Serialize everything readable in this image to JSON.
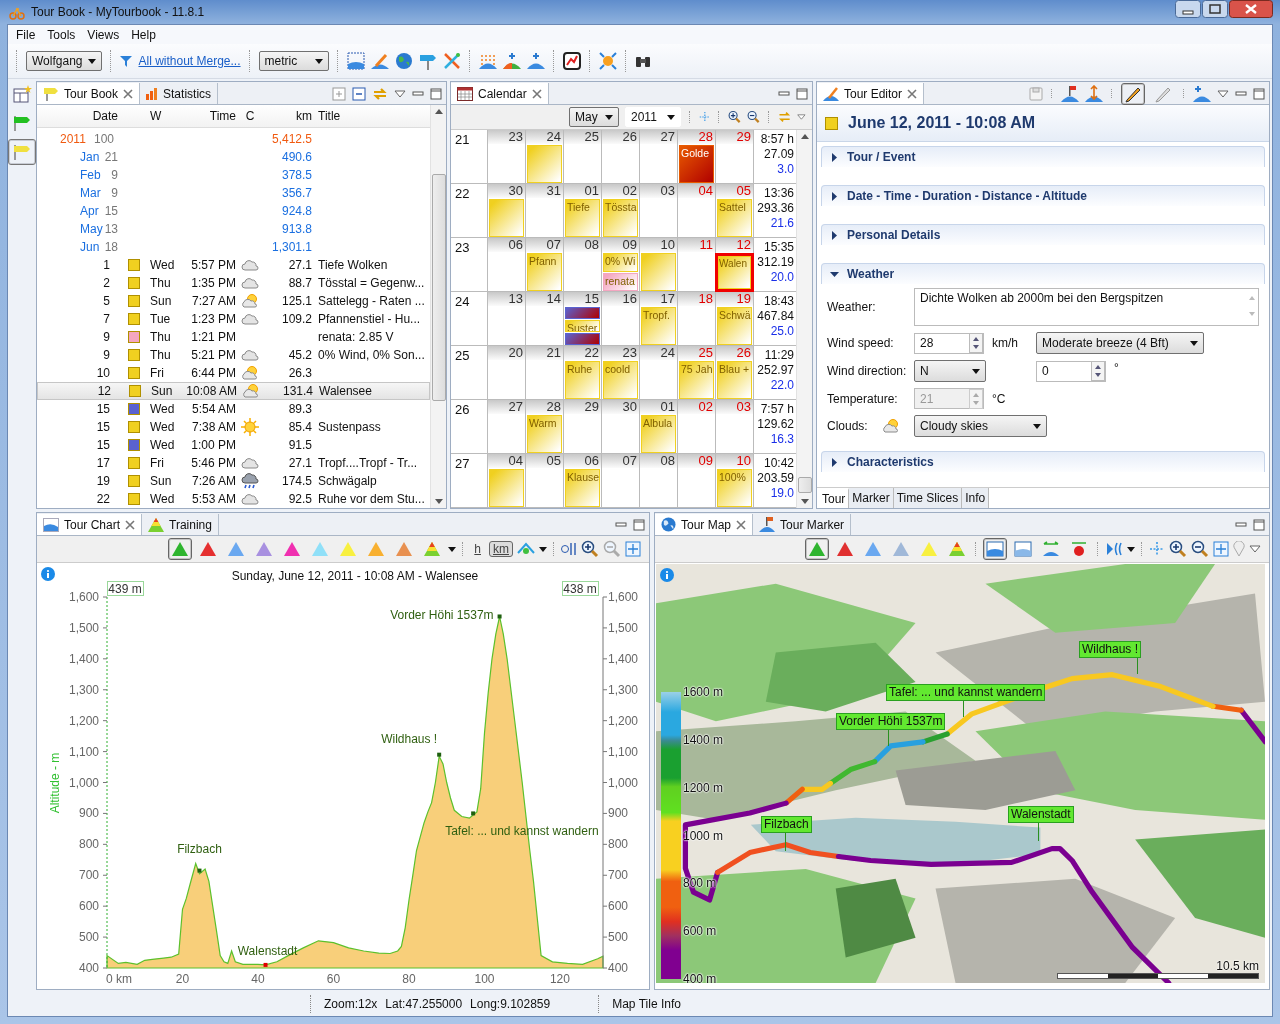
{
  "window": {
    "title": "Tour Book - MyTourbook - 11.8.1"
  },
  "menu": [
    "File",
    "Tools",
    "Views",
    "Help"
  ],
  "toolbar": {
    "person": "Wolfgang",
    "filter_link": "All without Merge...",
    "measurement": "metric"
  },
  "perspective_buttons": [
    {
      "kind": "layout",
      "selected": false
    },
    {
      "kind": "flag",
      "color": "#22c022",
      "selected": false
    },
    {
      "kind": "flag",
      "color": "#f0e040",
      "selected": true
    }
  ],
  "tour_book": {
    "tabs": [
      {
        "label": "Tour Book",
        "selected": true
      },
      {
        "label": "Statistics",
        "selected": false
      }
    ],
    "columns": [
      "Date",
      "W",
      "Time",
      "C",
      "km",
      "Title"
    ],
    "years": [
      {
        "year": "2011",
        "count": "100",
        "km": "5,412.5",
        "children": [
          {
            "month": "Jan",
            "count": "21",
            "km": "490.6"
          },
          {
            "month": "Feb",
            "count": "9",
            "km": "378.5"
          },
          {
            "month": "Mar",
            "count": "9",
            "km": "356.7"
          },
          {
            "month": "Apr",
            "count": "15",
            "km": "924.8"
          },
          {
            "month": "May",
            "count": "13",
            "km": "913.8"
          },
          {
            "month": "Jun",
            "count": "18",
            "km": "1,301.1",
            "children": [
              {
                "day": "1",
                "color": "#f0d020",
                "weekday": "Wed",
                "time": "5:57 PM",
                "kind": "cloudy",
                "km": "27.1",
                "title": "Tiefe Wolken",
                "selected": false
              },
              {
                "day": "2",
                "color": "#f0d020",
                "weekday": "Thu",
                "time": "1:35 PM",
                "kind": "cloudy",
                "km": "88.7",
                "title": "Tösstal = Gegenw...",
                "selected": false
              },
              {
                "day": "5",
                "color": "#f0d020",
                "weekday": "Sun",
                "time": "7:27 AM",
                "kind": "partly_sunny",
                "km": "125.1",
                "title": "Sattelegg - Raten ...",
                "selected": false
              },
              {
                "day": "7",
                "color": "#f0d020",
                "weekday": "Tue",
                "time": "1:23 PM",
                "kind": "cloudy",
                "km": "109.2",
                "title": "Pfannenstiel - Hu...",
                "selected": false
              },
              {
                "day": "9",
                "color": "#f4a6c0",
                "weekday": "Thu",
                "time": "1:21 PM",
                "title": "renata: 2.85 V",
                "selected": false
              },
              {
                "day": "9",
                "color": "#f0d020",
                "weekday": "Thu",
                "time": "5:21 PM",
                "kind": "cloudy",
                "km": "45.2",
                "title": "0% Wind, 0% Son...",
                "selected": false
              },
              {
                "day": "10",
                "color": "#f0d020",
                "weekday": "Fri",
                "time": "6:44 PM",
                "kind": "partly_sunny",
                "km": "26.3",
                "selected": false
              },
              {
                "day": "12",
                "color": "#f0d020",
                "weekday": "Sun",
                "time": "10:08 AM",
                "kind": "partly_sunny",
                "km": "131.4",
                "title": "Walensee",
                "selected": true
              },
              {
                "day": "15",
                "color": "#5a62d0",
                "weekday": "Wed",
                "time": "5:54 AM",
                "km": "89.3",
                "selected": false
              },
              {
                "day": "15",
                "color": "#f0d020",
                "weekday": "Wed",
                "time": "7:38 AM",
                "kind": "sunny",
                "km": "85.4",
                "title": "Sustenpass",
                "selected": false
              },
              {
                "day": "15",
                "color": "#5a62d0",
                "weekday": "Wed",
                "time": "1:00 PM",
                "km": "91.5",
                "selected": false
              },
              {
                "day": "17",
                "color": "#f0d020",
                "weekday": "Fri",
                "time": "5:46 PM",
                "kind": "cloudy",
                "km": "27.1",
                "title": "Tropf....Tropf - Tr...",
                "selected": false
              },
              {
                "day": "19",
                "color": "#f0d020",
                "weekday": "Sun",
                "time": "7:26 AM",
                "kind": "rain",
                "km": "174.5",
                "title": "Schwägalp",
                "selected": false
              },
              {
                "day": "22",
                "color": "#f0d020",
                "weekday": "Wed",
                "time": "5:53 AM",
                "kind": "cloudy",
                "km": "92.5",
                "title": "Ruhe vor dem Stu...",
                "selected": false
              }
            ]
          }
        ]
      }
    ]
  },
  "calendar": {
    "tab": "Calendar",
    "month": "May",
    "year": "2011",
    "weeks": [
      {
        "week": "21",
        "days": [
          {
            "day": "23"
          },
          {
            "day": "24",
            "tours": [
              {
                "color": "#f0d020",
                "selected": false
              }
            ]
          },
          {
            "day": "25"
          },
          {
            "day": "26"
          },
          {
            "day": "27"
          },
          {
            "day": "28",
            "tours": [
              {
                "color": "#e85a00",
                "title": "Golde",
                "selected": false
              }
            ]
          },
          {
            "day": "29"
          }
        ],
        "summary": [
          "8:57 h",
          "27.09",
          "3.0"
        ]
      },
      {
        "week": "22",
        "days": [
          {
            "day": "30",
            "tours": [
              {
                "color": "#f0d020",
                "selected": false
              }
            ]
          },
          {
            "day": "31"
          },
          {
            "day": "01",
            "tours": [
              {
                "color": "#f0d020",
                "title": "Tiefe",
                "selected": false
              }
            ]
          },
          {
            "day": "02",
            "tours": [
              {
                "color": "#f0d020",
                "title": "Tössta",
                "selected": false
              }
            ]
          },
          {
            "day": "03"
          },
          {
            "day": "04"
          },
          {
            "day": "05",
            "tours": [
              {
                "color": "#f0d020",
                "title": "Sattel",
                "selected": false
              }
            ]
          }
        ],
        "summary": [
          "13:36",
          "293.36",
          "21.6"
        ]
      },
      {
        "week": "23",
        "days": [
          {
            "day": "06"
          },
          {
            "day": "07",
            "tours": [
              {
                "color": "#f0d020",
                "title": "Pfann",
                "selected": false
              }
            ]
          },
          {
            "day": "08"
          },
          {
            "day": "09",
            "tours": [
              {
                "color": "#f0d020",
                "title": "0% Wi",
                "selected": false
              },
              {
                "color": "#f4a6c0",
                "title": "renata",
                "selected": false
              }
            ]
          },
          {
            "day": "10",
            "tours": [
              {
                "color": "#f0d020",
                "selected": false
              }
            ]
          },
          {
            "day": "11"
          },
          {
            "day": "12",
            "tours": [
              {
                "color": "#f0d020",
                "title": "Walen",
                "selected": true
              }
            ]
          }
        ],
        "summary": [
          "15:35",
          "312.19",
          "20.0"
        ]
      },
      {
        "week": "24",
        "days": [
          {
            "day": "13"
          },
          {
            "day": "14"
          },
          {
            "day": "15",
            "tours": [
              {
                "color": "#5a62d0",
                "selected": false
              },
              {
                "color": "#f0d020",
                "title": "Suster",
                "selected": false
              },
              {
                "color": "#5a62d0",
                "selected": false
              }
            ]
          },
          {
            "day": "16"
          },
          {
            "day": "17",
            "tours": [
              {
                "color": "#f0d020",
                "title": "Tropf.",
                "selected": false
              }
            ]
          },
          {
            "day": "18"
          },
          {
            "day": "19",
            "tours": [
              {
                "color": "#f0d020",
                "title": "Schwä",
                "selected": false
              }
            ]
          }
        ],
        "summary": [
          "18:43",
          "467.84",
          "25.0"
        ]
      },
      {
        "week": "25",
        "days": [
          {
            "day": "20"
          },
          {
            "day": "21"
          },
          {
            "day": "22",
            "tours": [
              {
                "color": "#f0d020",
                "title": "Ruhe",
                "selected": false
              }
            ]
          },
          {
            "day": "23",
            "tours": [
              {
                "color": "#f0d020",
                "title": "coold",
                "selected": false
              }
            ]
          },
          {
            "day": "24"
          },
          {
            "day": "25",
            "tours": [
              {
                "color": "#f0d020",
                "title": "75 Jah",
                "selected": false
              }
            ]
          },
          {
            "day": "26",
            "tours": [
              {
                "color": "#f0d020",
                "title": "Blau +",
                "selected": false
              }
            ]
          }
        ],
        "summary": [
          "11:29",
          "252.97",
          "22.0"
        ]
      },
      {
        "week": "26",
        "days": [
          {
            "day": "27"
          },
          {
            "day": "28",
            "tours": [
              {
                "color": "#f0d020",
                "title": "Warm",
                "selected": false
              }
            ]
          },
          {
            "day": "29"
          },
          {
            "day": "30"
          },
          {
            "day": "01",
            "tours": [
              {
                "color": "#f0d020",
                "title": "Albula",
                "selected": false
              }
            ]
          },
          {
            "day": "02"
          },
          {
            "day": "03"
          }
        ],
        "summary": [
          "7:57 h",
          "129.62",
          "16.3"
        ]
      },
      {
        "week": "27",
        "days": [
          {
            "day": "04",
            "tours": [
              {
                "color": "#f0d020",
                "selected": false
              }
            ]
          },
          {
            "day": "05"
          },
          {
            "day": "06",
            "tours": [
              {
                "color": "#f0d020",
                "title": "Klause",
                "selected": false
              }
            ]
          },
          {
            "day": "07"
          },
          {
            "day": "08"
          },
          {
            "day": "09"
          },
          {
            "day": "10",
            "tours": [
              {
                "color": "#f0d020",
                "title": "100%",
                "selected": false
              }
            ]
          }
        ],
        "summary": [
          "10:42",
          "203.59",
          "19.0"
        ]
      }
    ]
  },
  "tour_editor": {
    "tab": "Tour Editor",
    "edit_buttons": [
      {
        "selected": true
      },
      {
        "selected": false
      }
    ],
    "title": "June 12, 2011 - 10:08 AM",
    "sections": [
      {
        "label": "Tour / Event",
        "expanded": false
      },
      {
        "label": "Date - Time - Duration - Distance - Altitude",
        "expanded": false
      },
      {
        "label": "Personal Details",
        "expanded": false
      },
      {
        "label": "Weather",
        "expanded": true,
        "fields": {
          "weather_label": "Weather:",
          "weather_text": "Dichte Wolken ab 2000m bei den Bergspitzen",
          "wind_speed_label": "Wind speed:",
          "wind_speed": "28",
          "wind_speed_unit": "km/h",
          "wind_force": "Moderate breeze (4 Bft)",
          "wind_direction_label": "Wind direction:",
          "wind_direction": "N",
          "wind_degrees": "0",
          "degree_unit": "°",
          "temperature_label": "Temperature:",
          "temperature": "21",
          "temperature_disabled": true,
          "temperature_unit": "°C",
          "clouds_label": "Clouds:",
          "clouds": "Cloudy skies"
        }
      },
      {
        "label": "Characteristics",
        "expanded": false
      }
    ],
    "bottom_tabs": [
      {
        "label": "Tour",
        "selected": true
      },
      {
        "label": "Marker",
        "selected": false
      },
      {
        "label": "Time Slices",
        "selected": false
      },
      {
        "label": "Info",
        "selected": false
      }
    ]
  },
  "tour_chart": {
    "tabs": [
      {
        "label": "Tour Chart",
        "selected": true
      },
      {
        "label": "Training",
        "selected": false
      }
    ],
    "graph_buttons": [
      {
        "color": "#2fb52f",
        "kind": "solid",
        "selected": true
      },
      {
        "color": "#e53030",
        "kind": "solid",
        "selected": false
      },
      {
        "color": "#6aa8f0",
        "kind": "solid",
        "selected": false
      },
      {
        "color": "#a890e0",
        "kind": "solid",
        "selected": false
      },
      {
        "color": "#f030b0",
        "kind": "solid",
        "selected": false
      },
      {
        "color": "#90e0f8",
        "kind": "solid",
        "selected": false
      },
      {
        "color": "#f8f040",
        "kind": "solid",
        "selected": false
      },
      {
        "color": "#f8b030",
        "kind": "solid",
        "selected": false
      },
      {
        "color": "#e89050",
        "kind": "solid",
        "selected": false
      },
      {
        "kind": "layered",
        "selected": false
      }
    ],
    "unit_buttons": [
      {
        "label": "h",
        "selected": false
      },
      {
        "label": "km",
        "selected": true
      }
    ],
    "start_value": "439 m",
    "end_value": "438 m",
    "right_yticks": [
      "1,600",
      "1,500",
      "1,400",
      "1,300",
      "1,200",
      "1,100",
      "1,000",
      "900",
      "800",
      "700",
      "600",
      "500",
      "400"
    ],
    "chart_data": {
      "type": "area",
      "title": "Sunday, June 12, 2011 - 10:08 AM - Walensee",
      "ylabel": "Altitude - m",
      "x": [
        0,
        3,
        5,
        8,
        10,
        12,
        15,
        17,
        19,
        20,
        21,
        22,
        23.5,
        24.5,
        25,
        26,
        27,
        28,
        29,
        30,
        31,
        32,
        33,
        34,
        36,
        40,
        42,
        45,
        48,
        52,
        56,
        60,
        64,
        68,
        72,
        75,
        77,
        78,
        79,
        80,
        81,
        82,
        84,
        85,
        86,
        87,
        88,
        89,
        90,
        91,
        92,
        94,
        96,
        97,
        98,
        99,
        100,
        101,
        102,
        103,
        104,
        105,
        106,
        108,
        110,
        112,
        113,
        114,
        115,
        118,
        122,
        126,
        130,
        131.4
      ],
      "series": [
        {
          "color": "#5cc02c",
          "values": [
            440,
            415,
            418,
            412,
            425,
            428,
            432,
            435,
            445,
            590,
            625,
            670,
            738,
            705,
            710,
            720,
            680,
            600,
            520,
            440,
            420,
            415,
            455,
            420,
            412,
            412,
            410,
            420,
            440,
            465,
            488,
            482,
            465,
            455,
            448,
            447,
            455,
            470,
            530,
            620,
            700,
            780,
            870,
            905,
            935,
            1000,
            1085,
            1060,
            1000,
            950,
            910,
            890,
            885,
            895,
            905,
            980,
            1160,
            1290,
            1400,
            1480,
            1537,
            1480,
            1400,
            1200,
            1000,
            780,
            680,
            560,
            440,
            420,
            415,
            412,
            430,
            438
          ]
        }
      ],
      "xlim": [
        0,
        131.4
      ],
      "ylim": [
        400,
        1600
      ],
      "xticks": [
        {
          "value": 0,
          "label": "0 km"
        },
        20,
        40,
        60,
        80,
        100,
        120
      ],
      "yticks": [
        {
          "value": 1600,
          "label": "1,600"
        },
        {
          "value": 1500,
          "label": "1,500"
        },
        {
          "value": 1400,
          "label": "1,400"
        },
        {
          "value": 1300,
          "label": "1,300"
        },
        {
          "value": 1200,
          "label": "1,200"
        },
        {
          "value": 1100,
          "label": "1,100"
        },
        {
          "value": 1000,
          "label": "1,000"
        },
        900,
        800,
        700,
        600,
        500,
        400
      ]
    },
    "markers": [
      {
        "label": "Filzbach",
        "color": "#1f5f10"
      },
      {
        "label": "Walenstadt",
        "color": "#e00000"
      },
      {
        "label": "Wildhaus !",
        "color": "#1f5f10"
      },
      {
        "label": "Tafel: ... und kannst wandern",
        "color": "#1f5f10"
      },
      {
        "label": "Vorder Höhi 1537m",
        "color": "#1f5f10"
      }
    ]
  },
  "tour_map": {
    "tabs": [
      {
        "label": "Tour Map",
        "selected": true
      },
      {
        "label": "Tour Marker",
        "selected": false
      }
    ],
    "graph_buttons": [
      {
        "color": "#2fb52f",
        "kind": "solid",
        "selected": true
      },
      {
        "color": "#e03030",
        "kind": "solid",
        "selected": false
      },
      {
        "color": "#6aa8f0",
        "kind": "solid",
        "selected": false
      },
      {
        "color": "#a0b8d8",
        "kind": "solid",
        "selected": false
      },
      {
        "color": "#f8f040",
        "kind": "solid",
        "selected": false
      },
      {
        "kind": "layered",
        "selected": false
      }
    ],
    "view_buttons": [
      {
        "selected": true
      },
      {
        "selected": false
      },
      {
        "selected": false
      },
      {
        "selected": false
      }
    ],
    "legend": [
      "1600 m",
      "1400 m",
      "1200 m",
      "1000 m",
      "800 m",
      "600 m",
      "400 m"
    ],
    "markers": [
      {
        "label": "Wildhaus !"
      },
      {
        "label": "Tafel: ... und kannst wandern"
      },
      {
        "label": "Vorder Höhi 1537m"
      },
      {
        "label": "Filzbach"
      },
      {
        "label": "Walenstadt"
      }
    ],
    "scale": "10.5 km"
  },
  "status_bar": {
    "position": [
      "Zoom:12x",
      "Lat:47.255000",
      "Long:9.102859"
    ],
    "map_tile_info": "Map Tile Info"
  }
}
